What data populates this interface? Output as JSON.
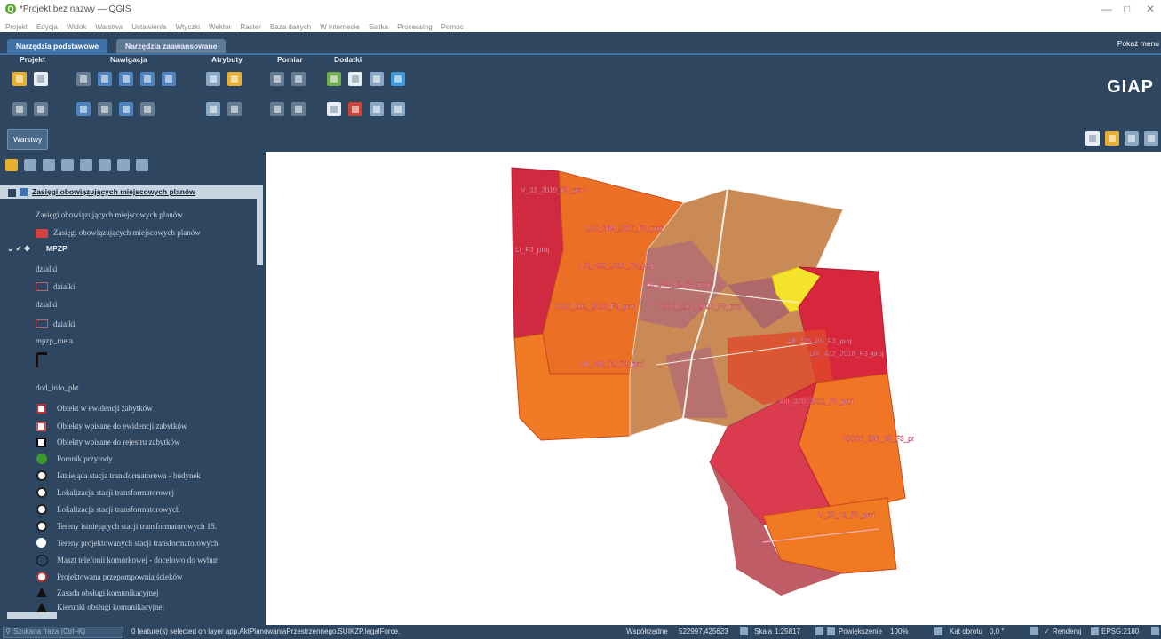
{
  "window": {
    "title": "*Projekt bez nazwy — QGIS",
    "controls": [
      "—",
      "□",
      "✕"
    ]
  },
  "menubar": [
    "Projekt",
    "Edycja",
    "Widok",
    "Warstwa",
    "Ustawienia",
    "Wtyczki",
    "Wektor",
    "Raster",
    "Baza danych",
    "W internecie",
    "Siatka",
    "Processing",
    "Pomoc"
  ],
  "ribbon": {
    "tabs": [
      "Narzędzia podstawowe",
      "Narzędzia zaawansowane"
    ],
    "show_menu": "Pokaż menu",
    "groups": [
      "Projekt",
      "Nawigacja",
      "Atrybuty",
      "Pomiar",
      "Dodatki"
    ],
    "brand": "GIAP",
    "layers_button": "Warstwy"
  },
  "layers_panel": {
    "top_layer": "Zasięgi obowiązujących miejscowych planów",
    "items": [
      {
        "label": "Zasięgi obowiązujących miejscowych planów",
        "type": "heading"
      },
      {
        "label": "Zasięgi obowiązujących miejscowych planów",
        "type": "legend-red"
      },
      {
        "label": "MPZP",
        "type": "group"
      },
      {
        "label": "dzialki",
        "type": "heading"
      },
      {
        "label": "dzialki",
        "type": "legend-outline"
      },
      {
        "label": "dzialki",
        "type": "heading"
      },
      {
        "label": "dzialki",
        "type": "legend-outline"
      },
      {
        "label": "mpzp_meta",
        "type": "heading"
      },
      {
        "label": "dod_info_pkt",
        "type": "heading"
      },
      {
        "label": "Obiekt w ewidencji zabytków",
        "type": "sym"
      },
      {
        "label": "Obiekty wpisane do ewidencji zabytków",
        "type": "sym"
      },
      {
        "label": "Obiekty wpisane do rejestru zabytków",
        "type": "sym"
      },
      {
        "label": "Pomnik przyrody",
        "type": "sym"
      },
      {
        "label": "Istniejąca stacja transformatorowa - budynek",
        "type": "sym"
      },
      {
        "label": "Lokalizacja stacji transformatorowej",
        "type": "sym"
      },
      {
        "label": "Lokalizacja stacji transformatorowych",
        "type": "sym"
      },
      {
        "label": "Tereny istniejących stacji transformatorowych 15.",
        "type": "sym"
      },
      {
        "label": "Tereny projektowanych stacji transformatorowych",
        "type": "sym"
      },
      {
        "label": "Maszt telefonii komórkowej - docelowo do wybur",
        "type": "sym"
      },
      {
        "label": "Projektowana przepompownia ścieków",
        "type": "sym"
      },
      {
        "label": "Zasada obsługi komunikacyjnej",
        "type": "sym"
      },
      {
        "label": "Kierunki obsługi komunikacyjnej",
        "type": "sym"
      }
    ]
  },
  "map": {
    "labels": [
      "V_33_2019_F3_proj",
      "LXV_369_2017_F3_proj",
      "LI_F3_proj",
      "LIX_422_2018_F3_proj",
      "LII_349_02_F3_proj",
      "XXVI_201_2020_F3_proj",
      "XXVII_214_2020_F3_proj",
      "LII_335_09_F3_proj",
      "LIX_422_2018_F3_proj",
      "LII_339_02_F3_proj",
      "XIII_320_2021_F3_proj",
      "XXXVI_296_05_F3_pr",
      "V_25_01_F3_proj"
    ],
    "colors": {
      "plan_red": "#d8263c",
      "plan_orange": "#f07a22",
      "plan_dark": "#c22d43",
      "parcel_tan": "#c98a56",
      "parcel_mauve": "#b06a7a",
      "yellow": "#f4e32a"
    }
  },
  "statusbar": {
    "search_placeholder": "Szukana fraza (Ctrl+K)",
    "message": "0 feature(s) selected on layer app.AktPlanowaniaPrzestrzennego.SUIKZP.legalForce.",
    "coord_label": "Współrzędne",
    "coord_value": "522997,425623",
    "scale_label": "Skala",
    "scale_value": "1:25817",
    "zoom_label": "Powiększenie",
    "zoom_value": "100%",
    "rotation_label": "Kąt obrotu",
    "rotation_value": "0,0 °",
    "render_label": "Renderuj",
    "crs": "EPSG:2180"
  }
}
